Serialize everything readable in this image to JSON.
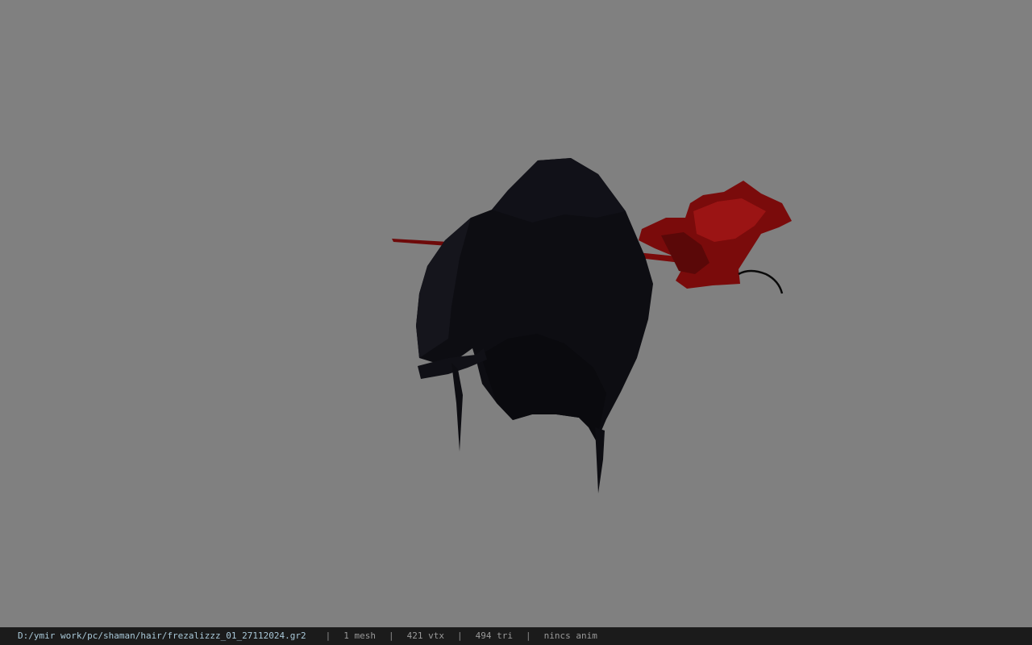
{
  "viewport": {
    "background_color": "#808080",
    "model": {
      "hair_color": "#0d0d12",
      "hair_shade": "#15151c",
      "ornament_color": "#7a0b0b",
      "ornament_highlight": "#a11515",
      "pin_color": "#6e0a0a",
      "wire_color": "#0a0a0a"
    }
  },
  "status_bar": {
    "background_color": "#1b1b1b",
    "file_path": "D:/ymir work/pc/shaman/hair/frezalizzz_01_27112024.gr2",
    "separator": "|",
    "mesh_count": "1 mesh",
    "vertex_count": "421 vtx",
    "triangle_count": "494 tri",
    "animation": "nincs anim"
  }
}
